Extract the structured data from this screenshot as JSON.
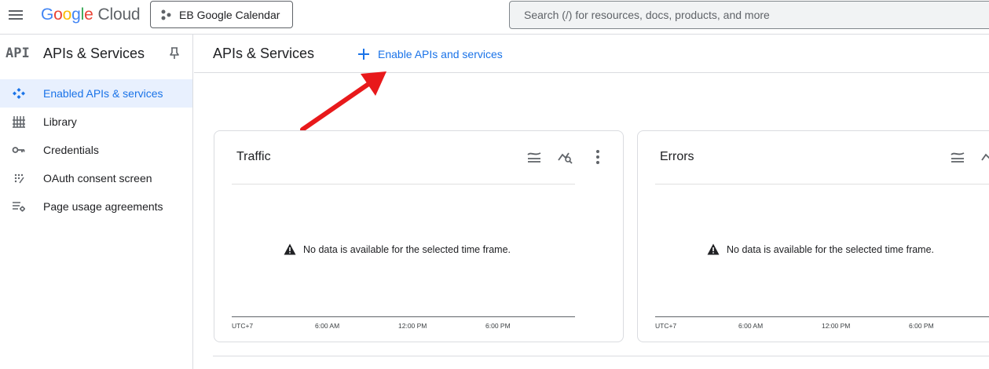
{
  "header": {
    "logo_letters": [
      "G",
      "o",
      "o",
      "g",
      "l",
      "e"
    ],
    "logo_suffix": "Cloud",
    "project_name": "EB Google Calendar",
    "search_placeholder": "Search (/) for resources, docs, products, and more"
  },
  "sidebar": {
    "badge": "API",
    "title": "APIs & Services",
    "items": [
      {
        "label": "Enabled APIs & services",
        "icon": "enabled-apis-icon",
        "active": true
      },
      {
        "label": "Library",
        "icon": "library-icon",
        "active": false
      },
      {
        "label": "Credentials",
        "icon": "key-icon",
        "active": false
      },
      {
        "label": "OAuth consent screen",
        "icon": "oauth-icon",
        "active": false
      },
      {
        "label": "Page usage agreements",
        "icon": "agreements-icon",
        "active": false
      }
    ]
  },
  "main": {
    "title": "APIs & Services",
    "enable_button": "Enable APIs and services",
    "cards": [
      {
        "title": "Traffic",
        "no_data": "No data is available for the selected time frame.",
        "ticks": [
          "UTC+7",
          "6:00 AM",
          "12:00 PM",
          "6:00 PM"
        ]
      },
      {
        "title": "Errors",
        "no_data": "No data is available for the selected time frame.",
        "ticks": [
          "UTC+7",
          "6:00 AM",
          "12:00 PM",
          "6:00 PM"
        ]
      }
    ]
  },
  "colors": {
    "accent": "#1a73e8",
    "active_bg": "#e8f0fe",
    "annotation_arrow": "#e8191b"
  }
}
